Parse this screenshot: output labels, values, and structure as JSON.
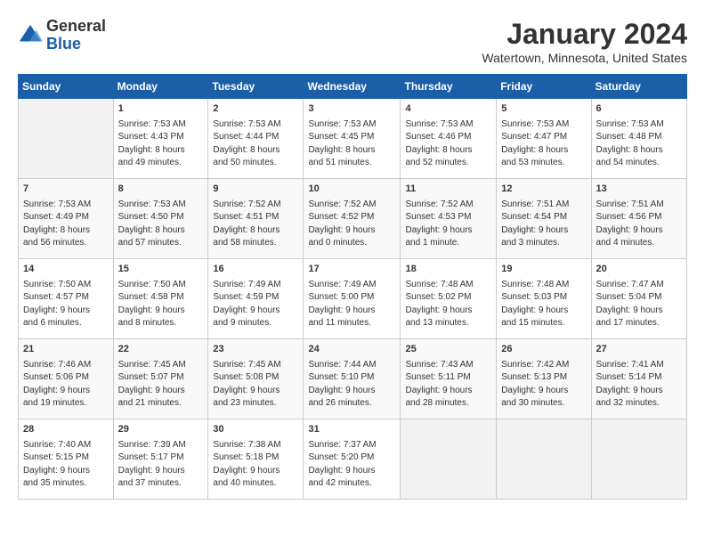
{
  "header": {
    "logo_line1": "General",
    "logo_line2": "Blue",
    "title": "January 2024",
    "subtitle": "Watertown, Minnesota, United States"
  },
  "days_of_week": [
    "Sunday",
    "Monday",
    "Tuesday",
    "Wednesday",
    "Thursday",
    "Friday",
    "Saturday"
  ],
  "weeks": [
    [
      {
        "num": "",
        "info": ""
      },
      {
        "num": "1",
        "info": "Sunrise: 7:53 AM\nSunset: 4:43 PM\nDaylight: 8 hours\nand 49 minutes."
      },
      {
        "num": "2",
        "info": "Sunrise: 7:53 AM\nSunset: 4:44 PM\nDaylight: 8 hours\nand 50 minutes."
      },
      {
        "num": "3",
        "info": "Sunrise: 7:53 AM\nSunset: 4:45 PM\nDaylight: 8 hours\nand 51 minutes."
      },
      {
        "num": "4",
        "info": "Sunrise: 7:53 AM\nSunset: 4:46 PM\nDaylight: 8 hours\nand 52 minutes."
      },
      {
        "num": "5",
        "info": "Sunrise: 7:53 AM\nSunset: 4:47 PM\nDaylight: 8 hours\nand 53 minutes."
      },
      {
        "num": "6",
        "info": "Sunrise: 7:53 AM\nSunset: 4:48 PM\nDaylight: 8 hours\nand 54 minutes."
      }
    ],
    [
      {
        "num": "7",
        "info": "Sunrise: 7:53 AM\nSunset: 4:49 PM\nDaylight: 8 hours\nand 56 minutes."
      },
      {
        "num": "8",
        "info": "Sunrise: 7:53 AM\nSunset: 4:50 PM\nDaylight: 8 hours\nand 57 minutes."
      },
      {
        "num": "9",
        "info": "Sunrise: 7:52 AM\nSunset: 4:51 PM\nDaylight: 8 hours\nand 58 minutes."
      },
      {
        "num": "10",
        "info": "Sunrise: 7:52 AM\nSunset: 4:52 PM\nDaylight: 9 hours\nand 0 minutes."
      },
      {
        "num": "11",
        "info": "Sunrise: 7:52 AM\nSunset: 4:53 PM\nDaylight: 9 hours\nand 1 minute."
      },
      {
        "num": "12",
        "info": "Sunrise: 7:51 AM\nSunset: 4:54 PM\nDaylight: 9 hours\nand 3 minutes."
      },
      {
        "num": "13",
        "info": "Sunrise: 7:51 AM\nSunset: 4:56 PM\nDaylight: 9 hours\nand 4 minutes."
      }
    ],
    [
      {
        "num": "14",
        "info": "Sunrise: 7:50 AM\nSunset: 4:57 PM\nDaylight: 9 hours\nand 6 minutes."
      },
      {
        "num": "15",
        "info": "Sunrise: 7:50 AM\nSunset: 4:58 PM\nDaylight: 9 hours\nand 8 minutes."
      },
      {
        "num": "16",
        "info": "Sunrise: 7:49 AM\nSunset: 4:59 PM\nDaylight: 9 hours\nand 9 minutes."
      },
      {
        "num": "17",
        "info": "Sunrise: 7:49 AM\nSunset: 5:00 PM\nDaylight: 9 hours\nand 11 minutes."
      },
      {
        "num": "18",
        "info": "Sunrise: 7:48 AM\nSunset: 5:02 PM\nDaylight: 9 hours\nand 13 minutes."
      },
      {
        "num": "19",
        "info": "Sunrise: 7:48 AM\nSunset: 5:03 PM\nDaylight: 9 hours\nand 15 minutes."
      },
      {
        "num": "20",
        "info": "Sunrise: 7:47 AM\nSunset: 5:04 PM\nDaylight: 9 hours\nand 17 minutes."
      }
    ],
    [
      {
        "num": "21",
        "info": "Sunrise: 7:46 AM\nSunset: 5:06 PM\nDaylight: 9 hours\nand 19 minutes."
      },
      {
        "num": "22",
        "info": "Sunrise: 7:45 AM\nSunset: 5:07 PM\nDaylight: 9 hours\nand 21 minutes."
      },
      {
        "num": "23",
        "info": "Sunrise: 7:45 AM\nSunset: 5:08 PM\nDaylight: 9 hours\nand 23 minutes."
      },
      {
        "num": "24",
        "info": "Sunrise: 7:44 AM\nSunset: 5:10 PM\nDaylight: 9 hours\nand 26 minutes."
      },
      {
        "num": "25",
        "info": "Sunrise: 7:43 AM\nSunset: 5:11 PM\nDaylight: 9 hours\nand 28 minutes."
      },
      {
        "num": "26",
        "info": "Sunrise: 7:42 AM\nSunset: 5:13 PM\nDaylight: 9 hours\nand 30 minutes."
      },
      {
        "num": "27",
        "info": "Sunrise: 7:41 AM\nSunset: 5:14 PM\nDaylight: 9 hours\nand 32 minutes."
      }
    ],
    [
      {
        "num": "28",
        "info": "Sunrise: 7:40 AM\nSunset: 5:15 PM\nDaylight: 9 hours\nand 35 minutes."
      },
      {
        "num": "29",
        "info": "Sunrise: 7:39 AM\nSunset: 5:17 PM\nDaylight: 9 hours\nand 37 minutes."
      },
      {
        "num": "30",
        "info": "Sunrise: 7:38 AM\nSunset: 5:18 PM\nDaylight: 9 hours\nand 40 minutes."
      },
      {
        "num": "31",
        "info": "Sunrise: 7:37 AM\nSunset: 5:20 PM\nDaylight: 9 hours\nand 42 minutes."
      },
      {
        "num": "",
        "info": ""
      },
      {
        "num": "",
        "info": ""
      },
      {
        "num": "",
        "info": ""
      }
    ]
  ]
}
